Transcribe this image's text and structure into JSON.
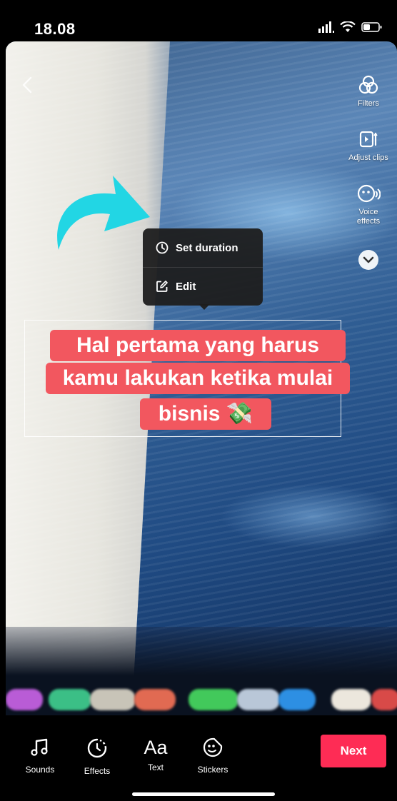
{
  "status_bar": {
    "time": "18.08"
  },
  "editor": {
    "right_rail": {
      "filters": "Filters",
      "adjust_clips": "Adjust clips",
      "voice_effects_line1": "Voice",
      "voice_effects_line2": "effects"
    },
    "popup": {
      "set_duration": "Set duration",
      "edit": "Edit"
    },
    "caption": {
      "line1": "Hal pertama yang harus",
      "line2": "kamu lakukan ketika mulai",
      "line3": "bisnis 💸"
    },
    "arrow_color": "#22d6e4",
    "caption_bg": "#f2575f"
  },
  "bottom_toolbar": {
    "sounds": "Sounds",
    "effects": "Effects",
    "text_icon": "Aa",
    "text": "Text",
    "stickers": "Stickers",
    "next": "Next",
    "next_color": "#fe2c55"
  }
}
